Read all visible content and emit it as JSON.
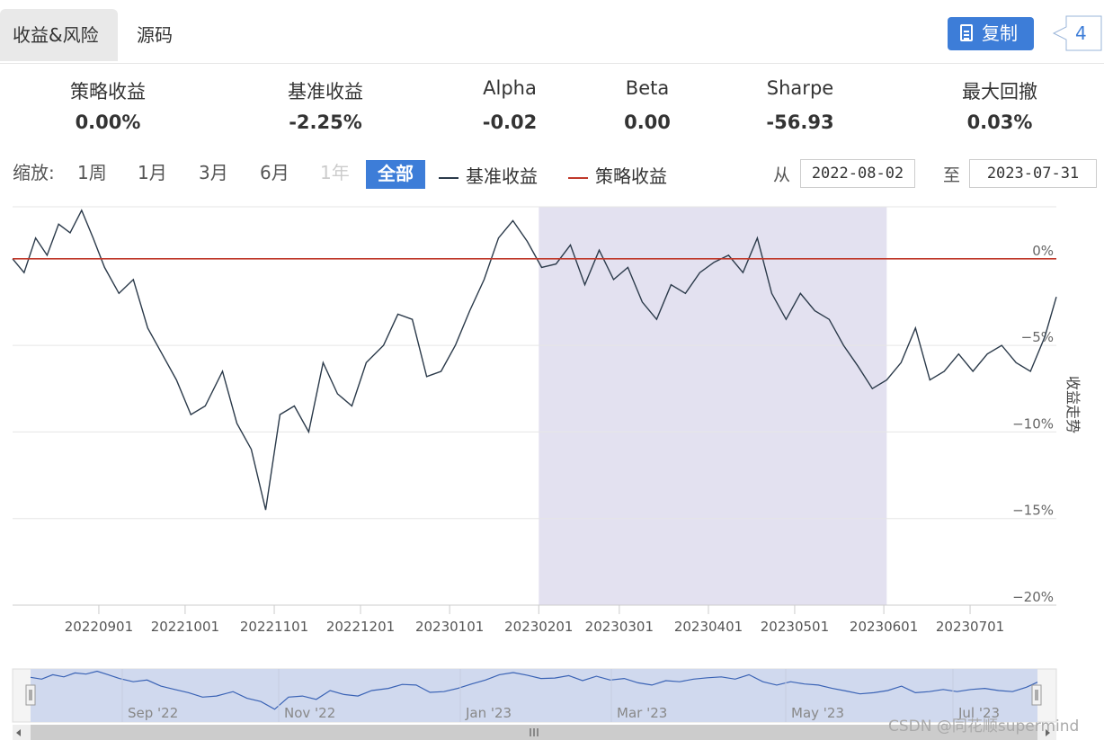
{
  "tabs": {
    "active": "收益&风险",
    "second": "源码"
  },
  "toolbar": {
    "copy_label": "复制",
    "count": "4"
  },
  "metrics": [
    {
      "label": "策略收益",
      "value": "0.00%"
    },
    {
      "label": "基准收益",
      "value": "-2.25%"
    },
    {
      "label": "Alpha",
      "value": "-0.02"
    },
    {
      "label": "Beta",
      "value": "0.00"
    },
    {
      "label": "Sharpe",
      "value": "-56.93"
    },
    {
      "label": "最大回撤",
      "value": "0.03%"
    }
  ],
  "zoom": {
    "label": "缩放:",
    "options": [
      "1周",
      "1月",
      "3月",
      "6月",
      "1年"
    ],
    "all_label": "全部"
  },
  "range": {
    "from_label": "从",
    "from": "2022-08-02",
    "to_label": "至",
    "to": "2023-07-31"
  },
  "watermark": "CSDN @同花顺supermind",
  "navigator": {
    "labels": [
      "Sep '22",
      "Nov '22",
      "Jan '23",
      "Mar '23",
      "May '23",
      "Jul '23"
    ]
  },
  "colors": {
    "benchmark": "#2b3a4a",
    "strategy": "#c0392b",
    "highlight": "#e3e1f0",
    "accent": "#3d7dd8"
  },
  "chart_data": {
    "type": "line",
    "y_axis_title": "收益走势",
    "y_unit": "%",
    "ylim": [
      -20,
      3
    ],
    "y_ticks": [
      0,
      -5,
      -10,
      -15,
      -20
    ],
    "y_tick_labels": [
      "0%",
      "−5%",
      "−10%",
      "−15%",
      "−20%"
    ],
    "x_tick_labels": [
      "20220901",
      "20221001",
      "20221101",
      "20221201",
      "20230101",
      "20230201",
      "20230301",
      "20230401",
      "20230501",
      "20230601",
      "20230701"
    ],
    "x_range": [
      "2022-08-02",
      "2023-07-31"
    ],
    "highlight_band": [
      "2023-02-01",
      "2023-06-02"
    ],
    "series": [
      {
        "name": "基准收益",
        "color": "#2b3a4a",
        "x": [
          "2022-08-02",
          "2022-08-06",
          "2022-08-10",
          "2022-08-14",
          "2022-08-18",
          "2022-08-22",
          "2022-08-26",
          "2022-08-30",
          "2022-09-03",
          "2022-09-08",
          "2022-09-13",
          "2022-09-18",
          "2022-09-23",
          "2022-09-28",
          "2022-10-03",
          "2022-10-08",
          "2022-10-14",
          "2022-10-19",
          "2022-10-24",
          "2022-10-29",
          "2022-11-03",
          "2022-11-08",
          "2022-11-13",
          "2022-11-18",
          "2022-11-23",
          "2022-11-28",
          "2022-12-03",
          "2022-12-09",
          "2022-12-14",
          "2022-12-19",
          "2022-12-24",
          "2022-12-29",
          "2023-01-03",
          "2023-01-08",
          "2023-01-13",
          "2023-01-18",
          "2023-01-23",
          "2023-01-28",
          "2023-02-02",
          "2023-02-07",
          "2023-02-12",
          "2023-02-17",
          "2023-02-22",
          "2023-02-27",
          "2023-03-04",
          "2023-03-09",
          "2023-03-14",
          "2023-03-19",
          "2023-03-24",
          "2023-03-29",
          "2023-04-03",
          "2023-04-08",
          "2023-04-13",
          "2023-04-18",
          "2023-04-23",
          "2023-04-28",
          "2023-05-03",
          "2023-05-08",
          "2023-05-13",
          "2023-05-18",
          "2023-05-23",
          "2023-05-28",
          "2023-06-02",
          "2023-06-07",
          "2023-06-12",
          "2023-06-17",
          "2023-06-22",
          "2023-06-27",
          "2023-07-02",
          "2023-07-07",
          "2023-07-12",
          "2023-07-17",
          "2023-07-22",
          "2023-07-27",
          "2023-07-31"
        ],
        "values": [
          0.0,
          -0.8,
          1.2,
          0.2,
          2.0,
          1.5,
          2.8,
          1.2,
          -0.5,
          -2.0,
          -1.2,
          -4.0,
          -5.5,
          -7.0,
          -9.0,
          -8.5,
          -6.5,
          -9.5,
          -11.0,
          -14.5,
          -9.0,
          -8.5,
          -10.0,
          -6.0,
          -7.8,
          -8.5,
          -6.0,
          -5.0,
          -3.2,
          -3.5,
          -6.8,
          -6.5,
          -5.0,
          -3.0,
          -1.2,
          1.2,
          2.2,
          1.0,
          -0.5,
          -0.3,
          0.8,
          -1.5,
          0.5,
          -1.2,
          -0.5,
          -2.5,
          -3.5,
          -1.5,
          -2.0,
          -0.8,
          -0.2,
          0.2,
          -0.8,
          1.2,
          -2.0,
          -3.5,
          -2.0,
          -3.0,
          -3.5,
          -5.0,
          -6.2,
          -7.5,
          -7.0,
          -6.0,
          -4.0,
          -7.0,
          -6.5,
          -5.5,
          -6.5,
          -5.5,
          -5.0,
          -6.0,
          -6.5,
          -4.5,
          -2.2
        ]
      },
      {
        "name": "策略收益",
        "color": "#c0392b",
        "x": [
          "2022-08-02",
          "2023-07-31"
        ],
        "values": [
          0.0,
          0.0
        ]
      }
    ],
    "navigator_labels": [
      "Sep '22",
      "Nov '22",
      "Jan '23",
      "Mar '23",
      "May '23",
      "Jul '23"
    ]
  }
}
